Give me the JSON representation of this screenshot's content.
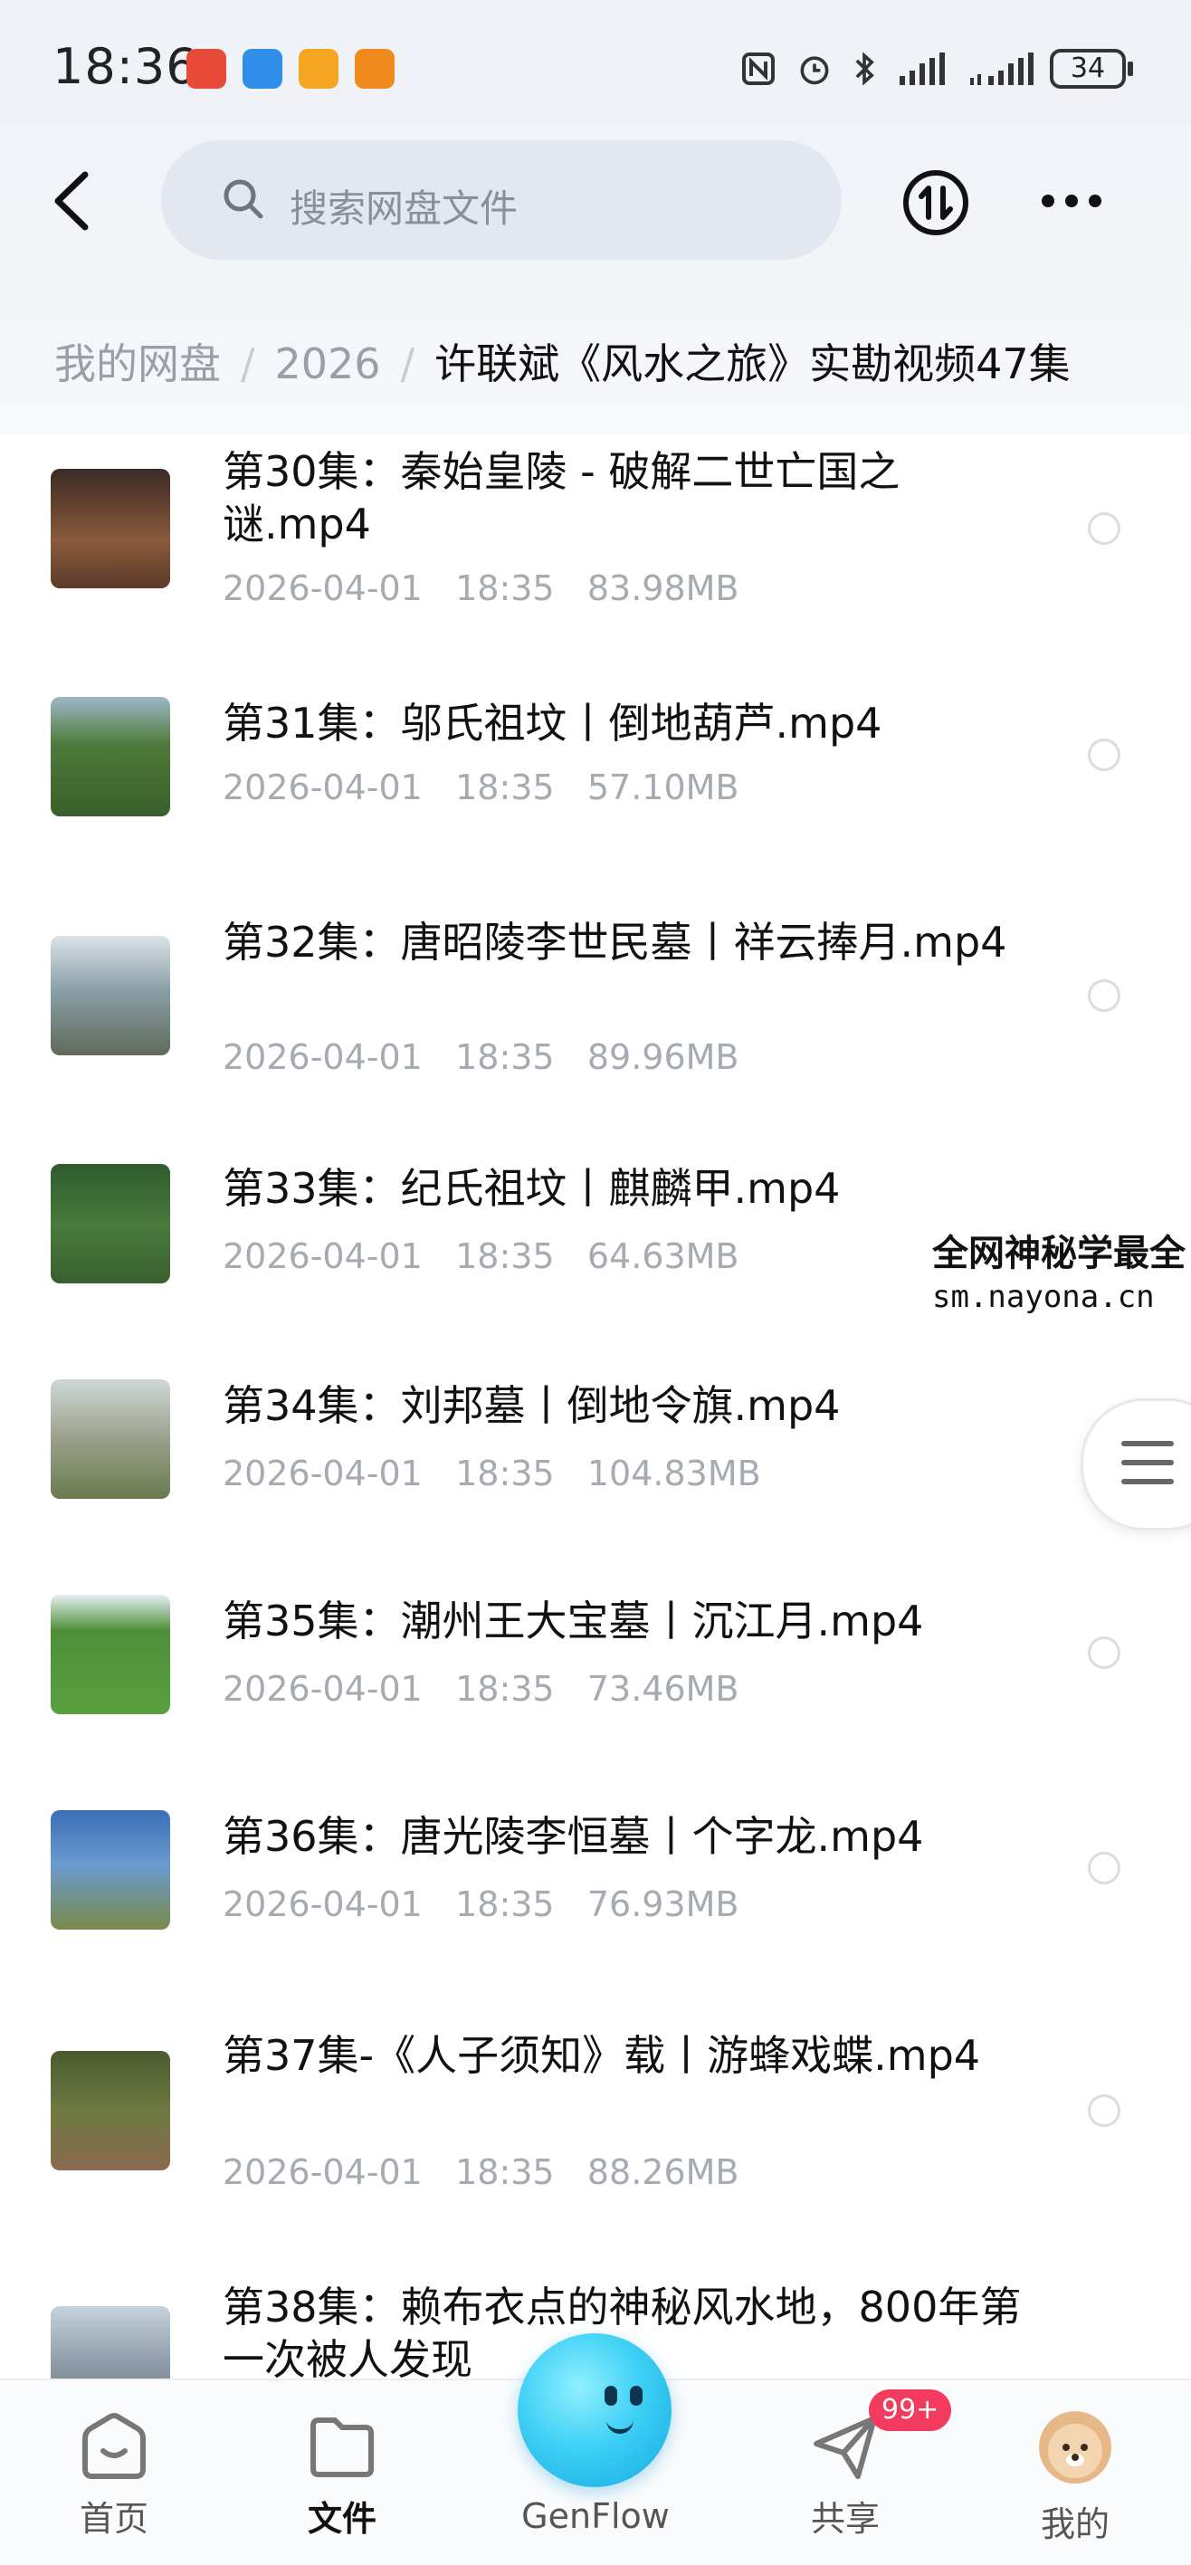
{
  "status_bar": {
    "time": "18:36",
    "battery": "34"
  },
  "header": {
    "search_placeholder": "搜索网盘文件"
  },
  "breadcrumb": {
    "root": "我的网盘",
    "folder": "2026",
    "current": "许联斌《风水之旅》实勘视频47集"
  },
  "files": [
    {
      "name": "第30集：秦始皇陵 - 破解二世亡国之谜.mp4",
      "date": "2026-04-01",
      "time": "18:35",
      "size": "83.98MB",
      "thumb": "#6b4a3a"
    },
    {
      "name": "第31集：邬氏祖坟丨倒地葫芦.mp4",
      "date": "2026-04-01",
      "time": "18:35",
      "size": "57.10MB",
      "thumb": "#4f7a3a"
    },
    {
      "name": "第32集：唐昭陵李世民墓丨祥云捧月.mp4",
      "date": "2026-04-01",
      "time": "18:35",
      "size": "89.96MB",
      "thumb": "#8aa0a8"
    },
    {
      "name": "第33集：纪氏祖坟丨麒麟甲.mp4",
      "date": "2026-04-01",
      "time": "18:35",
      "size": "64.63MB",
      "thumb": "#3f6a3c"
    },
    {
      "name": "第34集：刘邦墓丨倒地令旗.mp4",
      "date": "2026-04-01",
      "time": "18:35",
      "size": "104.83MB",
      "thumb": "#7d8a70"
    },
    {
      "name": "第35集：潮州王大宝墓丨沉江月.mp4",
      "date": "2026-04-01",
      "time": "18:35",
      "size": "73.46MB",
      "thumb": "#4e8f3a"
    },
    {
      "name": "第36集：唐光陵李恒墓丨个字龙.mp4",
      "date": "2026-04-01",
      "time": "18:35",
      "size": "76.93MB",
      "thumb": "#4d79b0"
    },
    {
      "name": "第37集-《人子须知》载丨游蜂戏蝶.mp4",
      "date": "2026-04-01",
      "time": "18:35",
      "size": "88.26MB",
      "thumb": "#5e6e3c"
    },
    {
      "name": "第38集：赖布衣点的神秘风水地，800年第一次被人发现",
      "date": "",
      "time": "",
      "size": "",
      "thumb": "#8b9aa8"
    }
  ],
  "watermark": {
    "line1": "全网神秘学最全",
    "line2": "sm.nayona.cn"
  },
  "tabs": {
    "home": "首页",
    "files": "文件",
    "genflow": "GenFlow",
    "share": "共享",
    "share_badge": "99+",
    "mine": "我的"
  }
}
